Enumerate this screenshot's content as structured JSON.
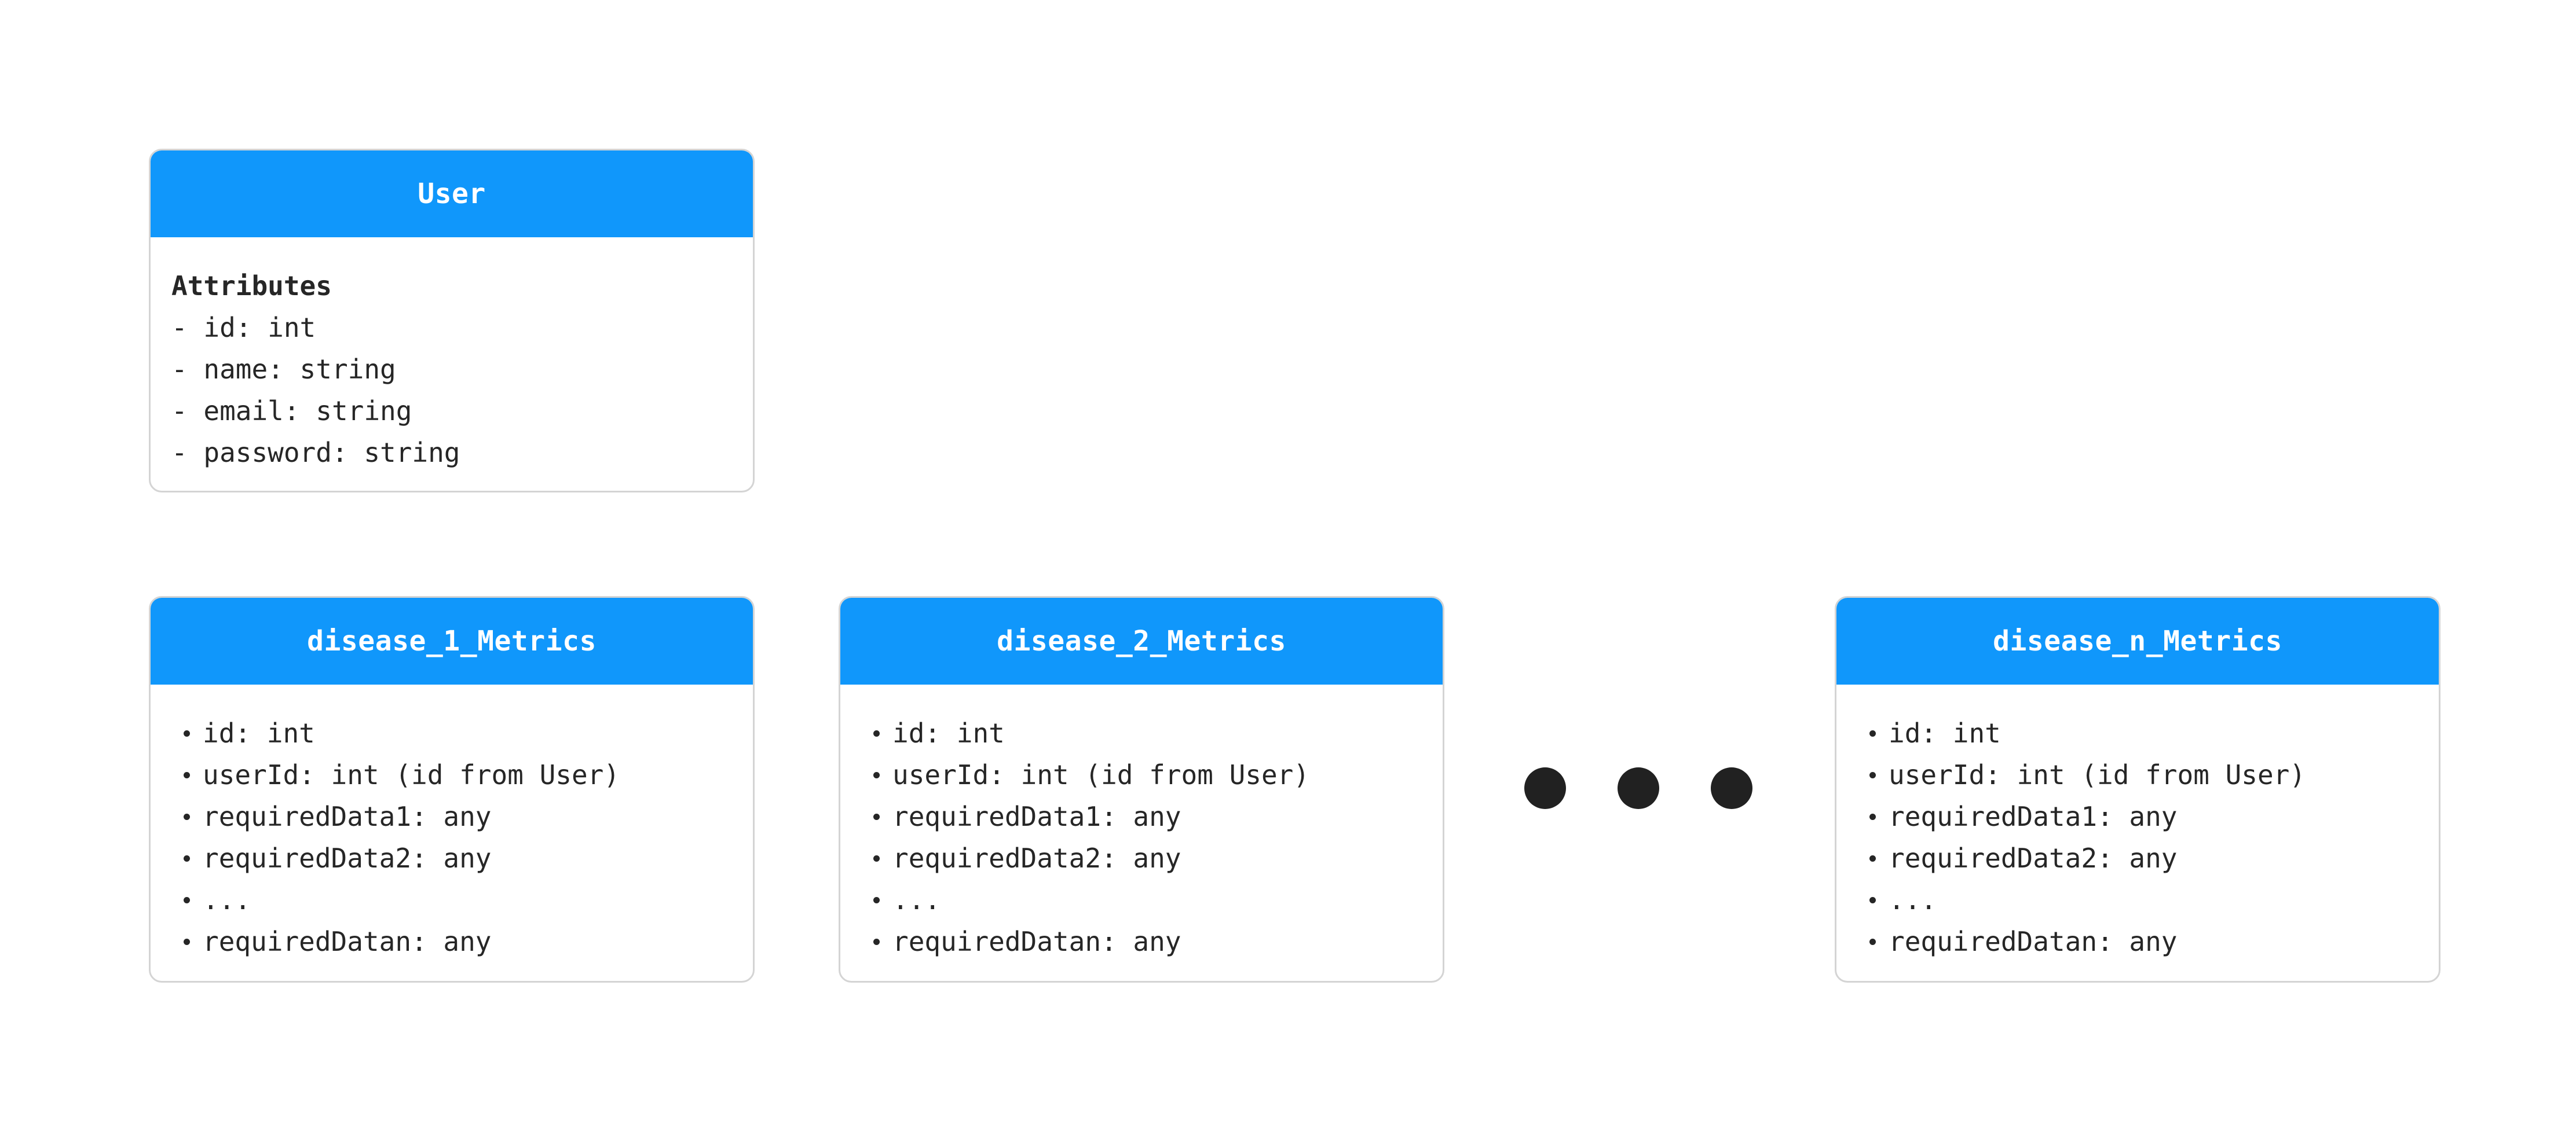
{
  "user": {
    "title": "User",
    "section_label": "Attributes",
    "attributes": [
      "- id: int",
      "- name: string",
      "- email: string",
      "- password: string"
    ]
  },
  "metrics_tables": [
    {
      "title": "disease_1_Metrics",
      "fields": [
        "id: int",
        "userId: int (id from User)",
        "requiredData1: any",
        "requiredData2: any",
        "...",
        "requiredDatan: any"
      ]
    },
    {
      "title": "disease_2_Metrics",
      "fields": [
        "id: int",
        "userId: int (id from User)",
        "requiredData1: any",
        "requiredData2: any",
        "...",
        "requiredDatan: any"
      ]
    },
    {
      "title": "disease_n_Metrics",
      "fields": [
        "id: int",
        "userId: int (id from User)",
        "requiredData1: any",
        "requiredData2: any",
        "...",
        "requiredDatan: any"
      ]
    }
  ],
  "colors": {
    "header": "#1097fb",
    "header_text": "#ffffff",
    "border": "#d4d4d4",
    "text": "#262626",
    "ellipsis_dot": "#212121"
  }
}
